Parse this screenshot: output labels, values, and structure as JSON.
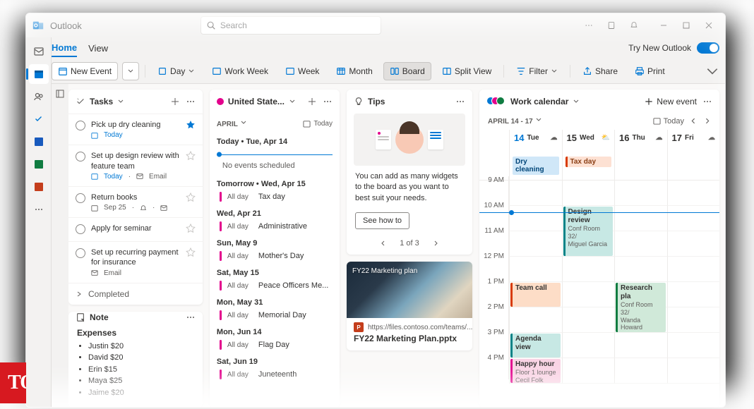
{
  "app": {
    "title": "Outlook"
  },
  "search": {
    "placeholder": "Search"
  },
  "tabs": {
    "home": "Home",
    "view": "View"
  },
  "tryNew": "Try New Outlook",
  "ribbon": {
    "newEvent": "New Event",
    "day": "Day",
    "workWeek": "Work Week",
    "week": "Week",
    "month": "Month",
    "board": "Board",
    "splitView": "Split View",
    "filter": "Filter",
    "share": "Share",
    "print": "Print"
  },
  "tasks": {
    "title": "Tasks",
    "items": [
      {
        "title": "Pick up dry cleaning",
        "metaDate": "Today",
        "todayMeta": true,
        "starred": true
      },
      {
        "title": "Set up design review with feature team",
        "metaDate": "Today",
        "metaExtra": "Email",
        "todayMeta": true,
        "starred": false
      },
      {
        "title": "Return books",
        "metaDate": "Sep 25",
        "hasBell": true,
        "hasMail": true,
        "starred": false
      },
      {
        "title": "Apply for seminar",
        "starred": false
      },
      {
        "title": "Set up recurring payment for insurance",
        "metaExtra": "Email",
        "starred": false
      }
    ],
    "completed": "Completed"
  },
  "note": {
    "title": "Note",
    "heading": "Expenses",
    "items": [
      "Justin $20",
      "David $20",
      "Erin $15",
      "Maya $25",
      "Jaime $20"
    ]
  },
  "holidays": {
    "title": "United State...",
    "month": "APRIL",
    "todayBtn": "Today",
    "todayLabel": "Today  •  Tue, Apr 14",
    "noEvents": "No events scheduled",
    "days": [
      {
        "date": "Tomorrow  •  Wed, Apr 15",
        "event": "Tax day"
      },
      {
        "date": "Wed, Apr 21",
        "event": "Administrative"
      },
      {
        "date": "Sun, May 9",
        "event": "Mother's Day"
      },
      {
        "date": "Sat, May 15",
        "event": "Peace Officers Me..."
      },
      {
        "date": "Mon, May 31",
        "event": "Memorial Day"
      },
      {
        "date": "Mon, Jun 14",
        "event": "Flag Day"
      },
      {
        "date": "Sat, Jun 19",
        "event": "Juneteenth"
      }
    ],
    "allDay": "All day"
  },
  "tips": {
    "title": "Tips",
    "text": "You can add as many widgets to the board as you want to best suit your needs.",
    "cta": "See how to",
    "pager": "1 of 3"
  },
  "file": {
    "thumbTitle": "FY22 Marketing plan",
    "url": "https://files.contoso.com/teams/...",
    "name": "FY22 Marketing Plan.pptx"
  },
  "calendar": {
    "title": "Work calendar",
    "newEvent": "New event",
    "range": "APRIL 14 - 17",
    "todayBtn": "Today",
    "days": [
      {
        "num": "14",
        "dow": "Tue",
        "today": true,
        "allday": "Dry cleaning",
        "alldayClass": ""
      },
      {
        "num": "15",
        "dow": "Wed",
        "allday": "Tax day",
        "alldayClass": "orange"
      },
      {
        "num": "16",
        "dow": "Thu"
      },
      {
        "num": "17",
        "dow": "Fri"
      }
    ],
    "hours": [
      "9 AM",
      "10 AM",
      "11 AM",
      "12 PM",
      "1 PM",
      "2 PM",
      "3 PM",
      "4 PM"
    ],
    "events": {
      "designReview": {
        "title": "Design review",
        "sub1": "Conf Room 32/",
        "sub2": "Miguel Garcia"
      },
      "teamCall": {
        "title": "Team call"
      },
      "agendaView": {
        "title": "Agenda view"
      },
      "happyHour": {
        "title": "Happy hour",
        "sub1": "Floor 1 lounge",
        "sub2": "Cecil Folk"
      },
      "researchPla": {
        "title": "Research pla",
        "sub1": "Conf Room 32/",
        "sub2": "Wanda Howard"
      }
    }
  },
  "toi": "TOI"
}
